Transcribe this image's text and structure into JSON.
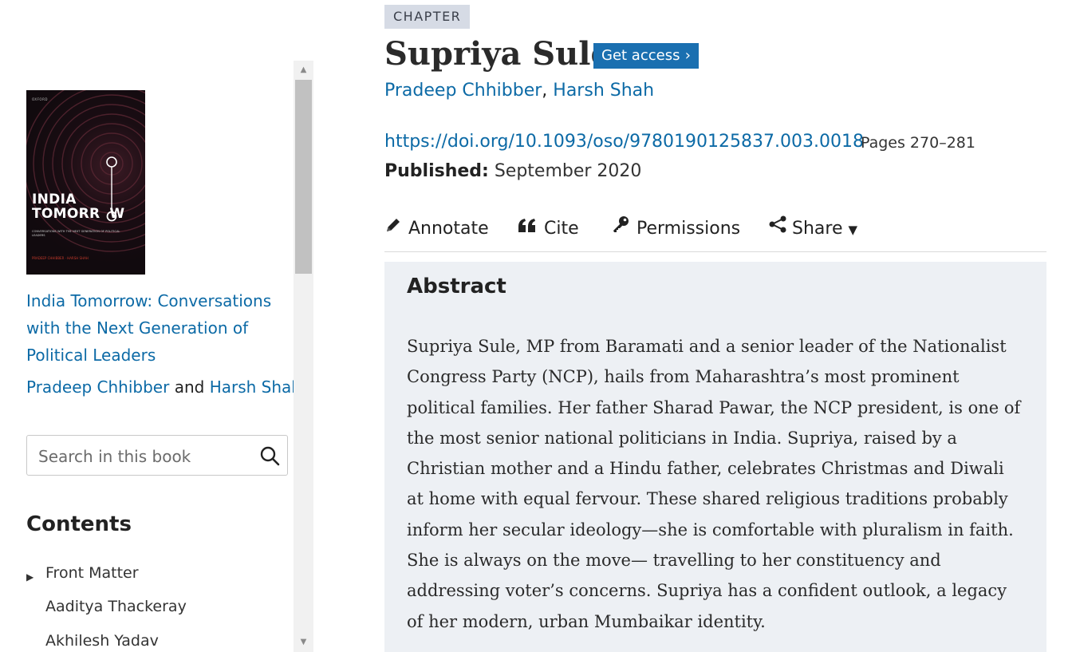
{
  "sidebar": {
    "cover": {
      "publisher": "OXFORD",
      "title_line1": "INDIA",
      "title_line2": "TOMORR",
      "title_line2_end": "W",
      "subtitle": "CONVERSATIONS WITH THE NEXT GENERATION OF POLITICAL LEADERS",
      "authors": "PRADEEP CHHIBBER · HARSH SHAH"
    },
    "book_title": "India Tomorrow: Conversations with the Next Generation of Political Leaders",
    "book_author_1": "Pradeep Chhibber",
    "book_author_join": " and ",
    "book_author_2": "Harsh Shah",
    "search": {
      "placeholder": "Search in this book"
    },
    "contents_heading": "Contents",
    "toc": [
      "Front Matter",
      "Aaditya Thackeray",
      "Akhilesh Yadav"
    ]
  },
  "chapter": {
    "badge": "CHAPTER",
    "title": "Supriya Sule",
    "get_access": "Get access",
    "author_1": "Pradeep Chhibber",
    "author_sep": ",",
    "author_2": "Harsh Shah",
    "doi": "https://doi.org/10.1093/oso/9780190125837.003.0018",
    "pages": "Pages 270–281",
    "published_label": "Published:",
    "published_value": " September 2020"
  },
  "toolbar": {
    "annotate": "Annotate",
    "cite": "Cite",
    "permissions": "Permissions",
    "share": "Share"
  },
  "abstract": {
    "heading": "Abstract",
    "text": "Supriya Sule, MP from Baramati and a senior leader of the Nationalist Congress Party (NCP), hails from Maharashtra’s most prominent political families. Her father Sharad Pawar, the NCP president, is one of the most senior national politicians in India. Supriya, raised by a Christian mother and a Hindu father, celebrates Christmas and Diwali at home with equal fervour. These shared religious traditions probably inform her secular ideology—she is comfortable with pluralism in faith. She is always on the move— travelling to her constituency and addressing voter’s concerns. Supriya has a confident outlook, a legacy of her modern, urban Mumbaikar identity."
  },
  "colors": {
    "link": "#0c6aa6",
    "accent_button": "#1a6fb0",
    "abstract_bg": "#edf0f4",
    "badge_bg": "#d6dbe5"
  }
}
